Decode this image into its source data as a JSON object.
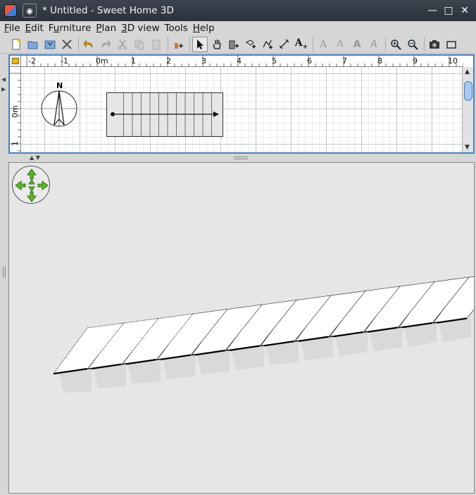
{
  "window": {
    "title": "* Untitled - Sweet Home 3D",
    "controls": [
      "minimize",
      "maximize",
      "close"
    ]
  },
  "menu": [
    {
      "label": "File",
      "mnemonic": "F",
      "rest": "ile"
    },
    {
      "label": "Edit",
      "mnemonic": "E",
      "rest": "dit"
    },
    {
      "label": "Furniture",
      "mnemonic": "u",
      "pre": "F",
      "rest": "rniture"
    },
    {
      "label": "Plan",
      "mnemonic": "P",
      "rest": "lan"
    },
    {
      "label": "3D view",
      "mnemonic": "3",
      "rest": "D view"
    },
    {
      "label": "Tools",
      "mnemonic": "",
      "rest": "Tools"
    },
    {
      "label": "Help",
      "mnemonic": "H",
      "rest": "elp"
    }
  ],
  "toolbar": {
    "buttons": [
      "new-home-icon",
      "open-icon",
      "save-icon",
      "preferences-icon",
      "undo-icon",
      "redo-icon",
      "cut-icon",
      "copy-icon",
      "paste-icon",
      "add-furniture-icon",
      "select-icon",
      "pan-icon",
      "create-walls-icon",
      "create-rooms-icon",
      "create-polylines-icon",
      "create-dimensions-icon",
      "add-text-icon",
      "increase-text-icon",
      "decrease-text-icon",
      "bold-text-icon",
      "italic-text-icon",
      "zoom-in-icon",
      "zoom-out-icon",
      "create-photo-icon",
      "create-video-icon"
    ],
    "selected": "select-icon"
  },
  "plan": {
    "ruler_top_labels": [
      "-2",
      "-1",
      "0m",
      "1",
      "2",
      "3",
      "4",
      "5",
      "6",
      "7",
      "8",
      "9",
      "10"
    ],
    "ruler_left_labels": [
      "0m",
      "1"
    ],
    "compass_label": "N"
  },
  "colors": {
    "selection_border": "#4a7fbf",
    "nav_arrow_green": "#5cb82a",
    "stair_top": "#ffffff",
    "stair_side": "#d9d9d9"
  }
}
